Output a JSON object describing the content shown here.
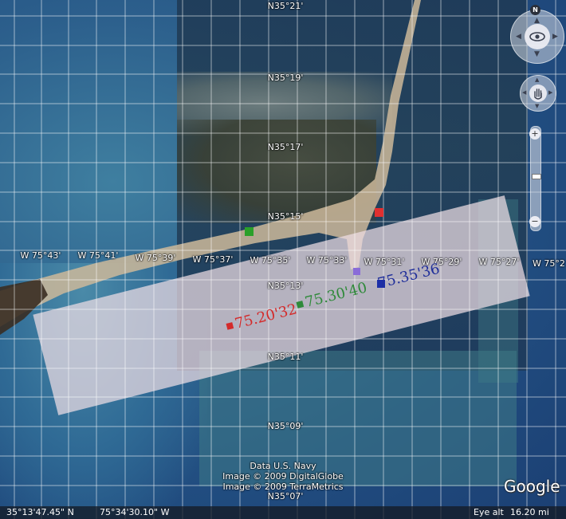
{
  "map": {
    "latitude_labels": [
      "N35°21'",
      "N35°19'",
      "N35°17'",
      "N35°15'",
      "N35°13'",
      "N35°11'",
      "N35°09'",
      "N35°07'"
    ],
    "longitude_labels": [
      "W 75°43'",
      "W 75°41'",
      "W 75°39'",
      "W 75°37'",
      "W 75°35'",
      "W 75°33'",
      "W 75°31'",
      "W 75°29'",
      "W 75°27'",
      "W 75°2"
    ],
    "markers": [
      {
        "name": "red",
        "color": "#e03030"
      },
      {
        "name": "green",
        "color": "#2aa02a"
      },
      {
        "name": "purple",
        "color": "#8a6cd8"
      },
      {
        "name": "blue",
        "color": "#1c2ea8"
      }
    ],
    "coordinate_labels": [
      {
        "text": "75.20'32",
        "color": "#d42a2a"
      },
      {
        "text": "75.30'40",
        "color": "#2f8a3a"
      },
      {
        "text": "75.35'36",
        "color": "#1f2e9a"
      }
    ]
  },
  "credits": {
    "line1": "Data U.S. Navy",
    "line2": "Image © 2009 DigitalGlobe",
    "line3": "Image © 2009 TerraMetrics"
  },
  "logo": "Google",
  "status": {
    "lat": "35°13'47.45\" N",
    "lon": "75°34'30.10\" W",
    "eye_alt_label": "Eye alt",
    "eye_alt_value": "16.20 mi"
  },
  "nav": {
    "compass_north": "N",
    "zoom_in": "+",
    "zoom_out": "−"
  }
}
